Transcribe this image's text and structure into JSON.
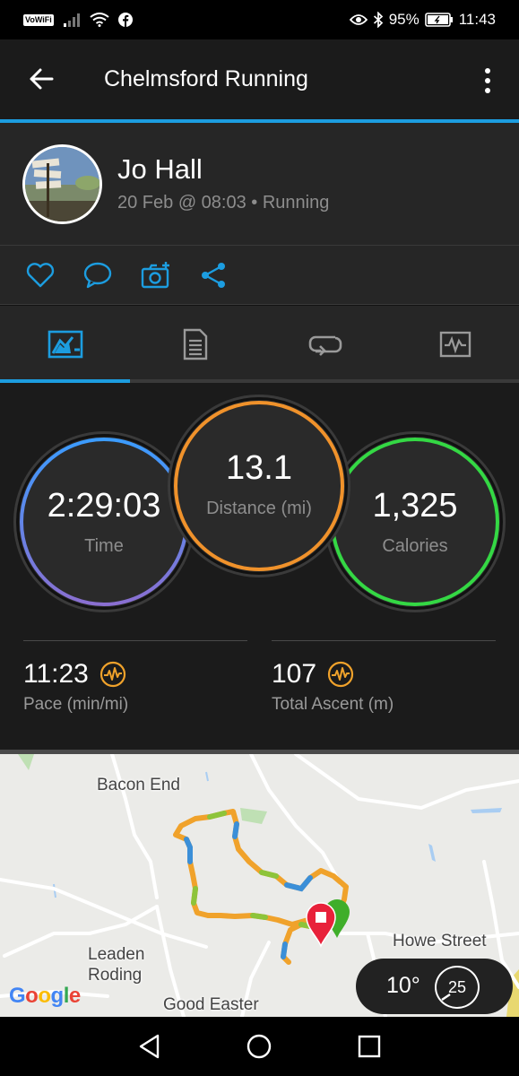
{
  "status_bar": {
    "carrier_badge": "VoWiFi",
    "battery": "95%",
    "time": "11:43"
  },
  "app_bar": {
    "title": "Chelmsford Running"
  },
  "profile": {
    "name": "Jo Hall",
    "meta": "20 Feb @ 08:03 • Running",
    "avatar_sign_text": "LAUGH DANCE RIDE"
  },
  "actions": [
    "heart-icon",
    "comment-icon",
    "add-photo-icon",
    "share-icon"
  ],
  "tabs": [
    "stats-tab",
    "details-tab",
    "laps-tab",
    "charts-tab"
  ],
  "colors": {
    "accent_blue": "#1c9de0",
    "time_ring_blue": "#3b9cff",
    "time_ring_purple": "#8a6fd1",
    "distance_ring": "#f0922b",
    "calories_ring": "#34d844",
    "pulse_icon": "#f0a22b"
  },
  "stats": {
    "time": {
      "value": "2:29:03",
      "label": "Time"
    },
    "distance": {
      "value": "13.1",
      "label": "Distance (mi)"
    },
    "calories": {
      "value": "1,325",
      "label": "Calories"
    },
    "pace": {
      "value": "11:23",
      "label": "Pace (min/mi)"
    },
    "ascent": {
      "value": "107",
      "label": "Total Ascent (m)"
    }
  },
  "map": {
    "labels": {
      "bacon_end": "Bacon End",
      "leaden": "Leaden",
      "roding": "Roding",
      "good_easter": "Good Easter",
      "howe_street": "Howe Street"
    },
    "attribution": "Google"
  },
  "weather": {
    "temperature": "10°",
    "wind_speed": "25"
  }
}
